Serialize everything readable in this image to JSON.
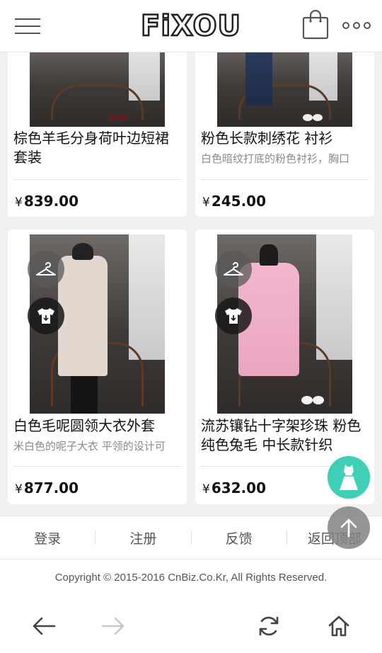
{
  "header": {
    "logo": "FiXOU",
    "menu_icon": "hamburger-menu-icon",
    "bag_icon": "shopping-bag-icon",
    "more_icon": "more-dots-icon"
  },
  "products": [
    {
      "title": "棕色羊毛分身荷叶边短裙套装",
      "description": "",
      "currency": "¥",
      "price": "839.00"
    },
    {
      "title": "粉色长款刺绣花 衬衫",
      "description": "白色暗纹打底的粉色衬衫，胸口",
      "currency": "¥",
      "price": "245.00"
    },
    {
      "title": "白色毛呢圆领大衣外套",
      "description": "米白色的呢子大衣 平领的设计可",
      "currency": "¥",
      "price": "877.00"
    },
    {
      "title": "流苏镶钻十字架珍珠 粉色纯色兔毛 中长款针织",
      "description": "",
      "currency": "¥",
      "price": "632.00"
    }
  ],
  "footer": {
    "links": [
      "登录",
      "注册",
      "反馈",
      "返回顶部"
    ],
    "copyright": "Copyright © 2015-2016 CnBiz.Co.Kr, All Rights Reserved."
  },
  "browser_bar": {
    "back_icon": "back-arrow-icon",
    "forward_icon": "forward-arrow-icon",
    "refresh_icon": "refresh-icon",
    "home_icon": "home-icon"
  },
  "colors": {
    "accent_teal": "#3fcfb6",
    "background": "#f1f1f1",
    "card": "#ffffff"
  }
}
